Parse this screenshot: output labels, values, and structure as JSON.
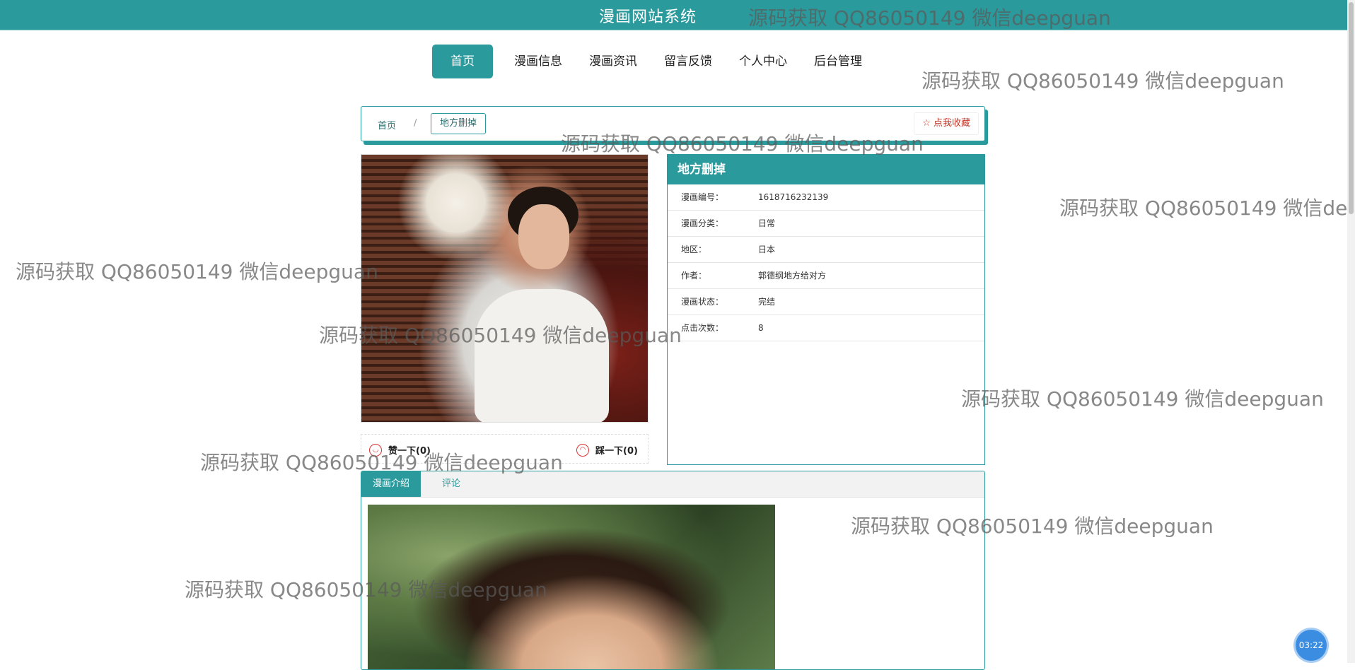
{
  "site": {
    "title": "漫画网站系统"
  },
  "nav": {
    "items": [
      {
        "label": "首页"
      },
      {
        "label": "漫画信息"
      },
      {
        "label": "漫画资讯"
      },
      {
        "label": "留言反馈"
      },
      {
        "label": "个人中心"
      },
      {
        "label": "后台管理"
      }
    ]
  },
  "breadcrumb": {
    "home": "首页",
    "separator": "/",
    "current": "地方删掉"
  },
  "favorite": {
    "label": "☆ 点我收藏"
  },
  "detail": {
    "title": "地方删掉",
    "fields": [
      {
        "key": "漫画编号：",
        "value": "1618716232139"
      },
      {
        "key": "漫画分类：",
        "value": "日常"
      },
      {
        "key": "地区：",
        "value": "日本"
      },
      {
        "key": "作者：",
        "value": "郭德纲地方给对方"
      },
      {
        "key": "漫画状态：",
        "value": "完结"
      },
      {
        "key": "点击次数：",
        "value": "8"
      }
    ]
  },
  "votes": {
    "up": "赞一下(0)",
    "down": "踩一下(0)"
  },
  "tabs": {
    "intro": "漫画介绍",
    "comments": "评论"
  },
  "watermark": "源码获取 QQ86050149 微信deepguan",
  "timer": "03:22",
  "colors": {
    "accent": "#2b9a9c",
    "favorite": "#c0392b"
  }
}
